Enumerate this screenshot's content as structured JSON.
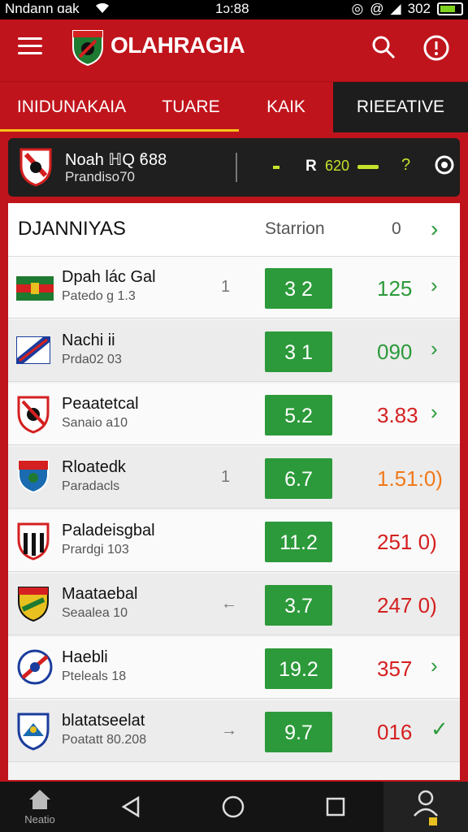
{
  "status_bar": {
    "carrier": "Nndann ɑak",
    "time": "1ɔ:88",
    "battery": "302"
  },
  "app": {
    "title": "OLAHRAGIA"
  },
  "tabs": [
    {
      "label": "INIDUNAKAIA"
    },
    {
      "label": "TUARE"
    },
    {
      "label": "KAIK"
    },
    {
      "label": "RIEEATIVE"
    }
  ],
  "match": {
    "name": "Noah ℍQ ϐ88",
    "sub": "Prandiso70",
    "letter": "R",
    "score": "620",
    "question": "?"
  },
  "list": {
    "title": "DJANNIYAS",
    "station_label": "Starrion",
    "count": "0",
    "rows": [
      {
        "name": "Dpah lác Gal",
        "sub": "Patedo g 1.3",
        "mid": "1",
        "score": "3 2",
        "value": "125",
        "value_color": "#2c9a3a",
        "chevron": "›"
      },
      {
        "name": "Nachi ii",
        "sub": "Prda02 03",
        "mid": "",
        "score": "3 1",
        "value": "090",
        "value_color": "#2c9a3a",
        "chevron": "›"
      },
      {
        "name": "Peaatetcal",
        "sub": "Sanaio a10",
        "mid": "",
        "score": "5.2",
        "value": "3.83",
        "value_color": "#d42020",
        "chevron": "›"
      },
      {
        "name": "Rloatedk",
        "sub": "Paradacls",
        "mid": "1",
        "score": "6.7",
        "value": "1.51:0)",
        "value_color": "#f07a1a",
        "chevron": ""
      },
      {
        "name": "Paladeisgbal",
        "sub": "Prardgi 103",
        "mid": "",
        "score": "11.2",
        "value": "251 0)",
        "value_color": "#d42020",
        "chevron": ""
      },
      {
        "name": "Maataebal",
        "sub": "Seaalea 10",
        "mid": "←",
        "score": "3.7",
        "value": "247 0)",
        "value_color": "#d42020",
        "chevron": ""
      },
      {
        "name": "Haebli",
        "sub": "Pteleals 18",
        "mid": "",
        "score": "19.2",
        "value": "357",
        "value_color": "#d42020",
        "chevron": "›"
      },
      {
        "name": "blatatseelat",
        "sub": "Poatatt 80.208",
        "mid": "→",
        "score": "9.7",
        "value": "016",
        "value_color": "#d42020",
        "chevron": "✓"
      }
    ]
  },
  "nav": {
    "home_label": "Neatio"
  },
  "colors": {
    "brand_red": "#c0141c",
    "accent_green": "#2c9a3a",
    "tab_underline": "#f5c518"
  }
}
